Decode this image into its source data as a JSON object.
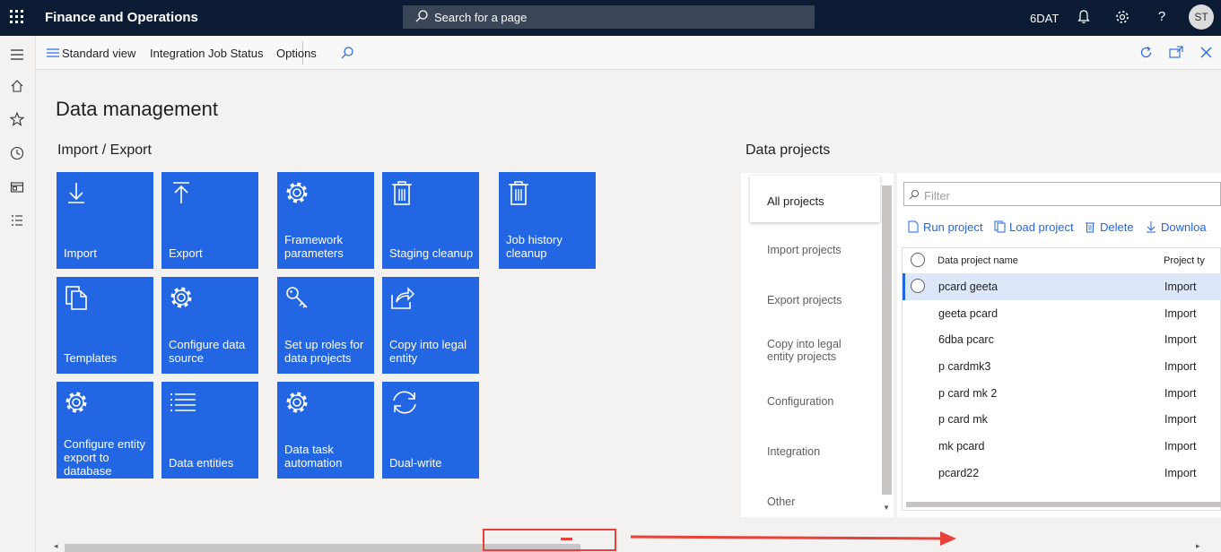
{
  "topbar": {
    "app_title": "Finance and Operations",
    "search_placeholder": "Search for a page",
    "company": "6DAT",
    "avatar_initials": "ST"
  },
  "actionpane": {
    "standard_view": "Standard view",
    "integration_job_status": "Integration Job Status",
    "options": "Options"
  },
  "page": {
    "title": "Data management",
    "import_export_title": "Import / Export",
    "data_projects_title": "Data projects"
  },
  "tiles": [
    {
      "label": "Import",
      "icon": "import-arrow-icon"
    },
    {
      "label": "Export",
      "icon": "export-arrow-icon"
    },
    {
      "label": "Framework parameters",
      "icon": "gear-icon"
    },
    {
      "label": "Staging cleanup",
      "icon": "trash-icon"
    },
    {
      "label": "Job history cleanup",
      "icon": "trash-icon"
    },
    {
      "label": "Templates",
      "icon": "documents-icon"
    },
    {
      "label": "Configure data source",
      "icon": "gear-icon"
    },
    {
      "label": "Set up roles for data projects",
      "icon": "key-icon"
    },
    {
      "label": "Copy into legal entity",
      "icon": "share-icon"
    },
    {
      "label": "Configure entity export to database",
      "icon": "gear-icon"
    },
    {
      "label": "Data entities",
      "icon": "list-icon"
    },
    {
      "label": "Data task automation",
      "icon": "gear-icon"
    },
    {
      "label": "Dual-write",
      "icon": "sync-icon"
    }
  ],
  "project_nav": {
    "items": [
      "All projects",
      "Import projects",
      "Export projects",
      "Copy into legal entity projects",
      "Configuration",
      "Integration",
      "Other"
    ],
    "selected": "All projects"
  },
  "project_grid": {
    "filter_placeholder": "Filter",
    "toolbar": [
      "Run project",
      "Load project",
      "Delete",
      "Downloa"
    ],
    "columns": [
      "Data project name",
      "Project ty"
    ],
    "rows": [
      {
        "name": "pcard geeta",
        "type": "Import"
      },
      {
        "name": "geeta pcard",
        "type": "Import"
      },
      {
        "name": "6dba pcarc",
        "type": "Import"
      },
      {
        "name": "p cardmk3",
        "type": "Import"
      },
      {
        "name": "p card mk 2",
        "type": "Import"
      },
      {
        "name": "p card mk",
        "type": "Import"
      },
      {
        "name": "mk pcard",
        "type": "Import"
      },
      {
        "name": "pcard22",
        "type": "Import"
      }
    ]
  },
  "colors": {
    "tile": "#2266e3",
    "topbar": "#0b1b33",
    "annotation": "#e8403a"
  }
}
